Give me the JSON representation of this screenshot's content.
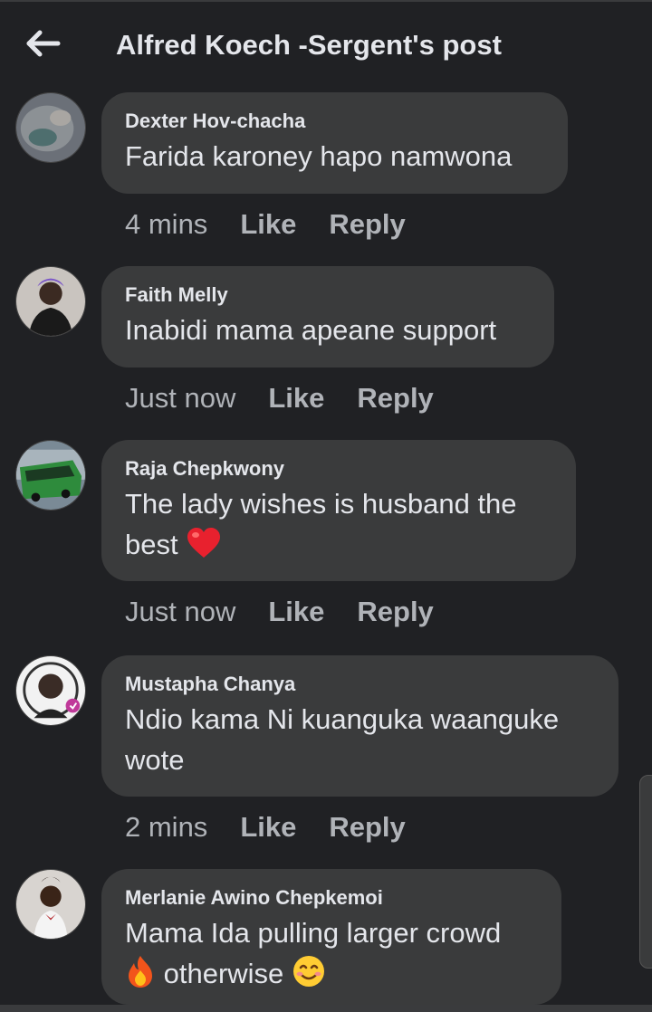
{
  "header": {
    "title": "Alfred Koech -Sergent's post",
    "back_icon": "arrow-left-icon"
  },
  "comments": [
    {
      "author": "Dexter Hov-chacha",
      "lines": [
        "Farida karoney hapo namwona"
      ],
      "time": "4 mins",
      "like": "Like",
      "reply": "Reply"
    },
    {
      "author": "Faith Melly",
      "lines": [
        "Inabidi mama apeane support"
      ],
      "time": "Just now",
      "like": "Like",
      "reply": "Reply"
    },
    {
      "author": "Raja Chepkwony",
      "lines": [
        "The lady wishes is husband the",
        "best"
      ],
      "time": "Just now",
      "like": "Like",
      "reply": "Reply",
      "emoji": "red-heart"
    },
    {
      "author": "Mustapha Chanya",
      "lines": [
        "Ndio kama Ni kuanguka waanguke",
        "wote"
      ],
      "time": "2 mins",
      "like": "Like",
      "reply": "Reply"
    },
    {
      "author": "Merlanie Awino Chepkemoi",
      "lines": [
        "Mama Ida pulling larger crowd",
        "otherwise"
      ],
      "emoji": "fire-and-smile"
    }
  ],
  "colors": {
    "background": "#202124",
    "bubble": "#3a3b3c",
    "text": "#e4e6eb",
    "muted": "#b0b3b8"
  }
}
